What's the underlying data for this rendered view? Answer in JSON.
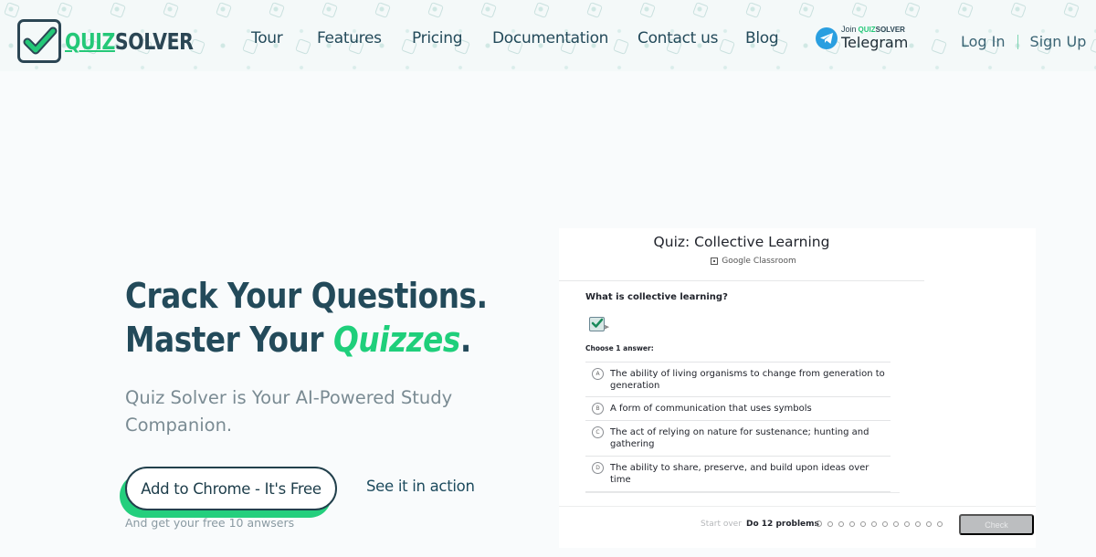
{
  "header": {
    "logo": {
      "quiz": "QUIZ",
      "solver": "SOLVER",
      "icon": "checkbox-check-icon"
    },
    "nav": [
      {
        "label": "Tour"
      },
      {
        "label": "Features"
      },
      {
        "label": "Pricing"
      },
      {
        "label": "Documentation"
      },
      {
        "label": "Contact us"
      },
      {
        "label": "Blog"
      }
    ],
    "telegram": {
      "join": "Join",
      "brand_quiz": "QUIZ",
      "brand_solver": "SOLVER",
      "label": "Telegram",
      "icon": "telegram-icon"
    },
    "auth": {
      "login": "Log In",
      "signup": "Sign Up"
    }
  },
  "hero": {
    "title_line1": "Crack Your Questions.",
    "title_line2_prefix": "Master Your ",
    "title_line2_accent": "Quizzes",
    "title_line2_suffix": ".",
    "subtitle": "Quiz Solver is Your AI-Powered Study Companion.",
    "cta_label": "Add to Chrome - It's Free",
    "secondary_label": "See it in action",
    "cta_note": "And get your free 10 anwsers"
  },
  "quiz_preview": {
    "title": "Quiz: Collective Learning",
    "source": "Google Classroom",
    "question": "What is collective learning?",
    "choose_label": "Choose 1 answer:",
    "options": [
      {
        "letter": "A",
        "text": "The ability of living organisms to change from generation to generation"
      },
      {
        "letter": "B",
        "text": "A form of communication that uses symbols"
      },
      {
        "letter": "C",
        "text": "The act of relying on nature for sustenance; hunting and gathering"
      },
      {
        "letter": "D",
        "text": "The ability to share, preserve, and build upon ideas over time"
      }
    ],
    "start_over": "Start over",
    "problems_label": "Do 12 problems",
    "problem_count": 12,
    "check_label": "Check"
  },
  "colors": {
    "brand_dark": "#234a5a",
    "brand_green": "#1fcf7b",
    "telegram_blue": "#2a9fe0"
  }
}
